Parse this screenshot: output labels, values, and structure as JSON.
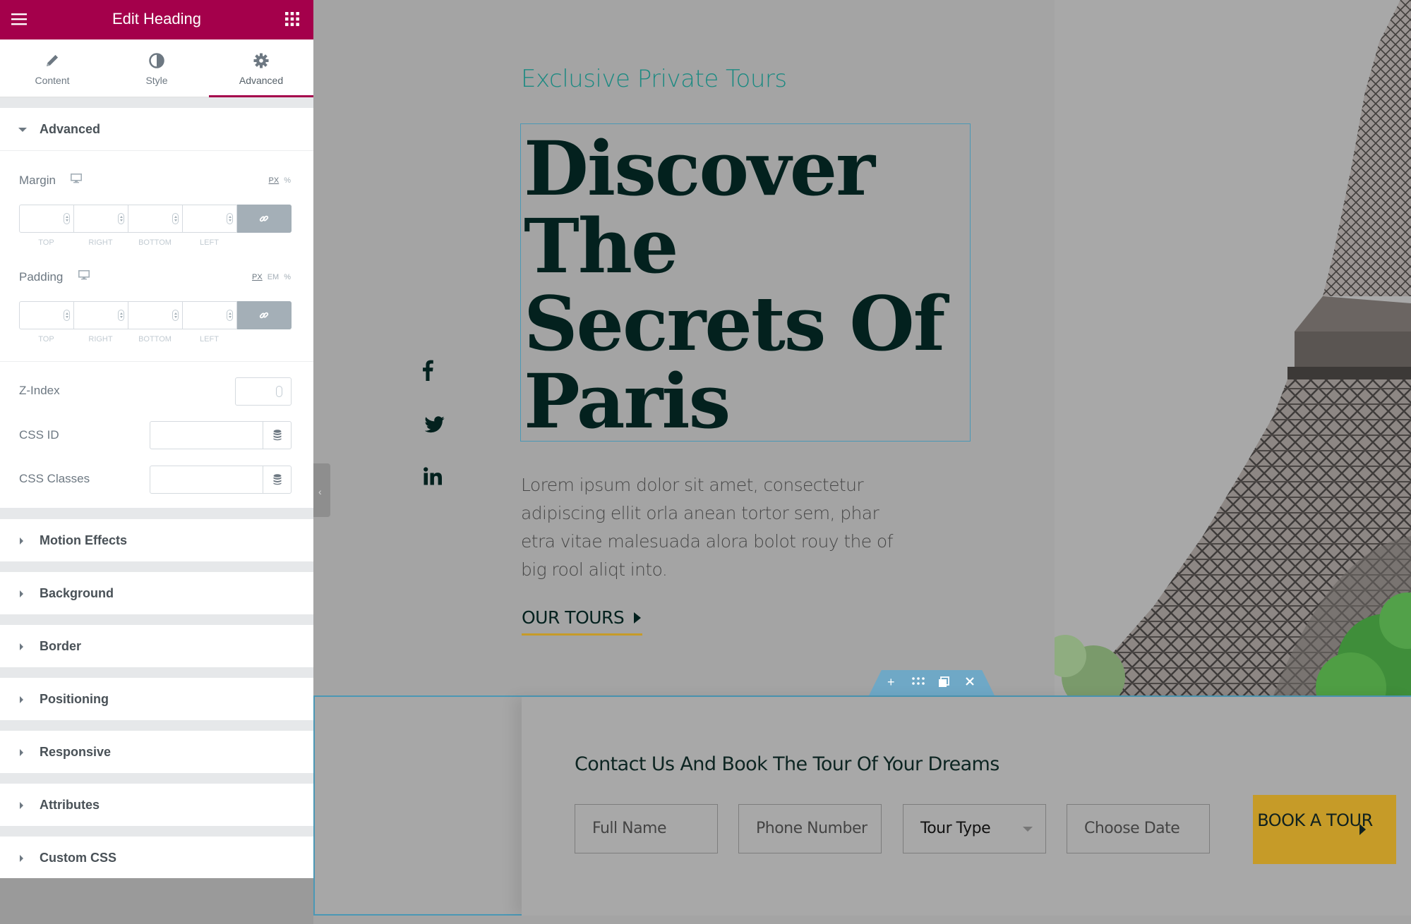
{
  "panel": {
    "title": "Edit Heading",
    "tabs": [
      {
        "label": "Content",
        "icon": "pencil-icon"
      },
      {
        "label": "Style",
        "icon": "half-circle-icon"
      },
      {
        "label": "Advanced",
        "icon": "gear-icon",
        "active": true
      }
    ],
    "advanced": {
      "title": "Advanced",
      "margin": {
        "label": "Margin",
        "units": [
          "PX",
          "%"
        ],
        "active_unit": "PX",
        "values": {
          "top": "",
          "right": "",
          "bottom": "",
          "left": ""
        },
        "dim_labels": [
          "TOP",
          "RIGHT",
          "BOTTOM",
          "LEFT"
        ]
      },
      "padding": {
        "label": "Padding",
        "units": [
          "PX",
          "EM",
          "%"
        ],
        "active_unit": "PX",
        "values": {
          "top": "",
          "right": "",
          "bottom": "",
          "left": ""
        },
        "dim_labels": [
          "TOP",
          "RIGHT",
          "BOTTOM",
          "LEFT"
        ]
      },
      "z_index": {
        "label": "Z-Index",
        "value": ""
      },
      "css_id": {
        "label": "CSS ID",
        "value": ""
      },
      "css_classes": {
        "label": "CSS Classes",
        "value": ""
      }
    },
    "collapsed_sections": [
      "Motion Effects",
      "Background",
      "Border",
      "Positioning",
      "Responsive",
      "Attributes",
      "Custom CSS"
    ]
  },
  "preview": {
    "kicker": "Exclusive Private Tours",
    "heading_lines": [
      "Discover",
      "The",
      "Secrets Of",
      "Paris"
    ],
    "social": [
      "facebook-icon",
      "twitter-icon",
      "linkedin-icon"
    ],
    "lead": "Lorem ipsum dolor sit amet, consectetur adipiscing ellit orla anean tortor sem, phar etra vitae malesuada alora bolot rouy the of big rool aliqt into.",
    "cta": "OUR TOURS",
    "contact": {
      "title": "Contact Us And Book The Tour Of Your Dreams",
      "fields": [
        {
          "placeholder": "Full Name"
        },
        {
          "placeholder": "Phone Number"
        },
        {
          "placeholder": "Tour Type",
          "select": true
        },
        {
          "placeholder": "Choose Date"
        }
      ],
      "button": "BOOK A TOUR"
    }
  },
  "colors": {
    "brand": "#a4004b",
    "accent_teal": "#1d8a82",
    "heading": "#03211e",
    "gold": "#c69b28",
    "selection": "#4b98b5"
  }
}
